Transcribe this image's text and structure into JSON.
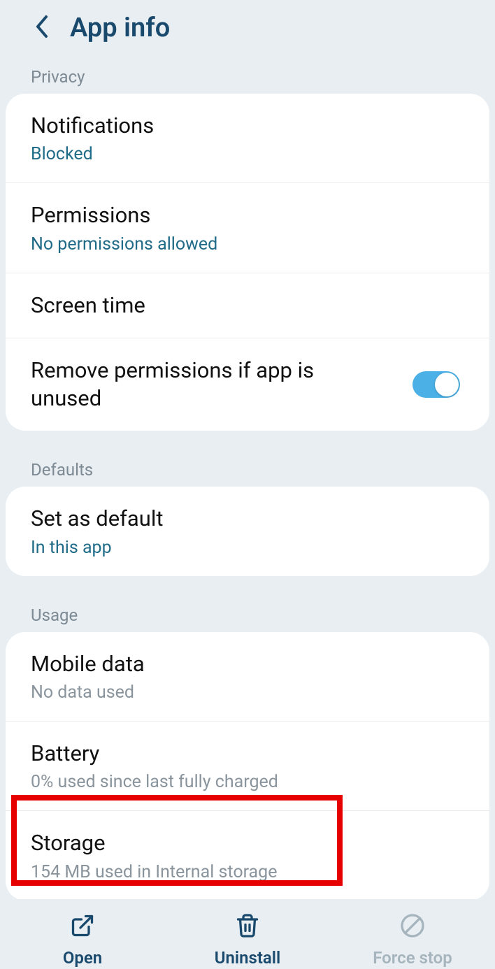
{
  "header": {
    "title": "App info"
  },
  "sections": {
    "privacy": {
      "header": "Privacy",
      "notifications": {
        "title": "Notifications",
        "sub": "Blocked"
      },
      "permissions": {
        "title": "Permissions",
        "sub": "No permissions allowed"
      },
      "screentime": {
        "title": "Screen time"
      },
      "remove_perms": {
        "title": "Remove permissions if app is unused",
        "toggle": true
      }
    },
    "defaults": {
      "header": "Defaults",
      "setdefault": {
        "title": "Set as default",
        "sub": "In this app"
      }
    },
    "usage": {
      "header": "Usage",
      "mobiledata": {
        "title": "Mobile data",
        "sub": "No data used"
      },
      "battery": {
        "title": "Battery",
        "sub": "0% used since last fully charged"
      },
      "storage": {
        "title": "Storage",
        "sub": "154 MB used in Internal storage"
      }
    }
  },
  "bottom": {
    "open": "Open",
    "uninstall": "Uninstall",
    "forcestop": "Force stop"
  }
}
